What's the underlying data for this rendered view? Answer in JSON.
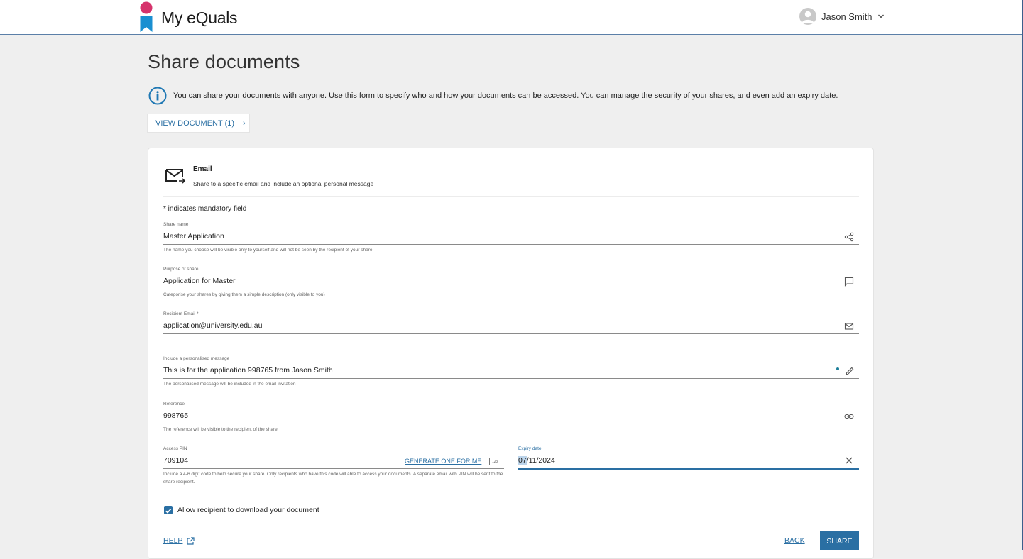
{
  "header": {
    "brand": "My eQuals",
    "user_name": "Jason Smith"
  },
  "page": {
    "title": "Share documents",
    "info_text": "You can share your documents with anyone. Use this form to specify who and how your documents can be accessed. You can manage the security of your shares, and even add an expiry date.",
    "view_document_label": "VIEW DOCUMENT (1)"
  },
  "share_method": {
    "title": "Email",
    "description": "Share to a specific email and include an optional personal message"
  },
  "form": {
    "mandatory_note": "* indicates mandatory field",
    "share_name": {
      "label": "Share name",
      "value": "Master Application",
      "hint": "The name you choose will be visible only to yourself and will not be seen by the recipient of your share"
    },
    "purpose": {
      "label": "Purpose of share",
      "value": "Application for Master",
      "hint": "Categorise your shares by giving them a simple description (only visible to you)"
    },
    "recipient_email": {
      "label": "Recipient Email *",
      "value": "application@university.edu.au"
    },
    "message": {
      "label": "Include a personalised message",
      "value": "This is for the application 998765 from Jason Smith",
      "hint": "The personalised message will be included in the email invitation"
    },
    "reference": {
      "label": "Reference",
      "value": "998765",
      "hint": "The reference will be visible to the recipient of the share"
    },
    "access_pin": {
      "label": "Access PIN",
      "value": "709104",
      "generate_label": "GENERATE ONE FOR ME",
      "badge": "123",
      "hint": "Include a 4-6 digit code to help secure your share. Only recipients who have this code will able to access your documents. A separate email with PIN will be sent to the share recipient."
    },
    "expiry": {
      "label": "Expiry date",
      "value_day": "07",
      "value_rest": "/11/2024"
    },
    "allow_download": {
      "label": "Allow recipient to download your document",
      "checked": true
    }
  },
  "actions": {
    "help": "HELP",
    "back": "BACK",
    "share": "SHARE"
  },
  "colors": {
    "accent": "#2a6fa3",
    "logo_pink": "#d6336c",
    "logo_blue": "#1a8fd1",
    "info_icon": "#1f78b4"
  }
}
